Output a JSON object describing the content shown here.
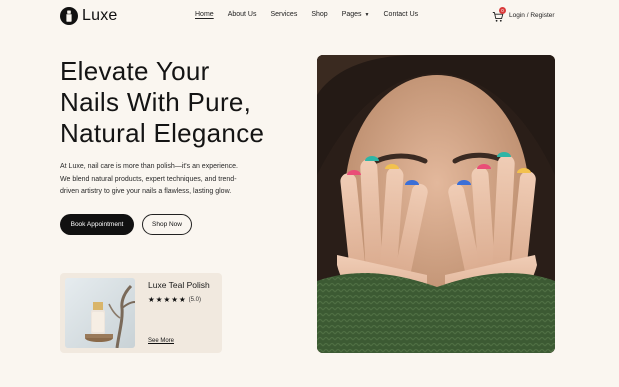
{
  "brand": {
    "name": "Luxe"
  },
  "nav": {
    "items": [
      {
        "label": "Home",
        "active": true
      },
      {
        "label": "About Us"
      },
      {
        "label": "Services"
      },
      {
        "label": "Shop"
      },
      {
        "label": "Pages",
        "dropdown": true
      },
      {
        "label": "Contact Us"
      }
    ]
  },
  "header": {
    "cart_icon": "shopping-cart-icon",
    "cart_count": "0",
    "login_label": "Login / Register"
  },
  "hero": {
    "headline": [
      "Elevate Your",
      "Nails With Pure,",
      "Natural Elegance"
    ],
    "intro_lines": [
      "At Luxe, nail care is more than polish—it's an experience.",
      "We blend natural products, expert techniques, and trend-",
      "driven artistry to give your nails a flawless, lasting glow."
    ],
    "primary_button": "Book Appointment",
    "secondary_button": "Shop Now"
  },
  "product_card": {
    "title": "Luxe Teal Polish",
    "rating": 5,
    "rating_text": "(5.0)",
    "link_label": "See More"
  },
  "colors": {
    "background": "#faf6f0",
    "card_background": "#f1e9df",
    "primary": "#111111",
    "badge": "#d93a3a",
    "sweater": "#3c5a33"
  }
}
